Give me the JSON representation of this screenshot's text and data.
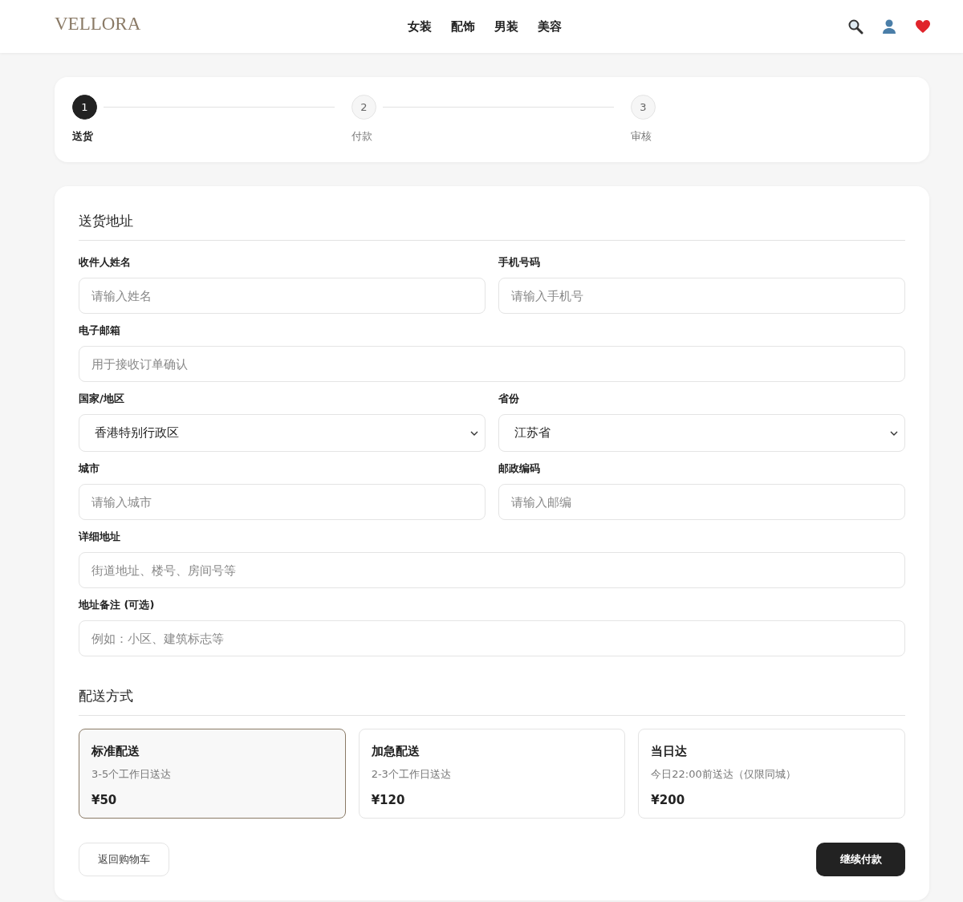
{
  "header": {
    "logo": "VELLORA",
    "nav": [
      {
        "label": "女装"
      },
      {
        "label": "配饰"
      },
      {
        "label": "男装"
      },
      {
        "label": "美容"
      }
    ]
  },
  "steps": [
    {
      "number": "1",
      "label": "送货",
      "selected": true
    },
    {
      "number": "2",
      "label": "付款",
      "selected": false
    },
    {
      "number": "3",
      "label": "审核",
      "selected": false
    }
  ],
  "address": {
    "title": "送货地址",
    "rows": [
      [
        {
          "label": "收件人姓名",
          "kind": "input",
          "placeholder": "请输入姓名"
        },
        {
          "label": "手机号码",
          "kind": "input",
          "placeholder": "请输入手机号"
        }
      ],
      [
        {
          "label": "电子邮箱",
          "kind": "input",
          "placeholder": "用于接收订单确认"
        }
      ],
      [
        {
          "label": "国家/地区",
          "kind": "select",
          "value": "香港特别行政区"
        },
        {
          "label": "省份",
          "kind": "select",
          "value": "江苏省"
        }
      ],
      [
        {
          "label": "城市",
          "kind": "input",
          "placeholder": "请输入城市"
        },
        {
          "label": "邮政编码",
          "kind": "input",
          "placeholder": "请输入邮编"
        }
      ],
      [
        {
          "label": "详细地址",
          "kind": "input",
          "placeholder": "街道地址、楼号、房间号等"
        }
      ],
      [
        {
          "label": "地址备注 (可选)",
          "kind": "input",
          "placeholder": "例如：小区、建筑标志等"
        }
      ]
    ]
  },
  "shipping": {
    "title": "配送方式",
    "options": [
      {
        "name": "标准配送",
        "desc": "3-5个工作日送达",
        "price": "¥50",
        "selected": true
      },
      {
        "name": "加急配送",
        "desc": "2-3个工作日送达",
        "price": "¥120",
        "selected": false
      },
      {
        "name": "当日达",
        "desc": "今日22:00前送达（仅限同城）",
        "price": "¥200",
        "selected": false
      }
    ]
  },
  "actions": {
    "back": "返回购物车",
    "next": "继续付款"
  }
}
